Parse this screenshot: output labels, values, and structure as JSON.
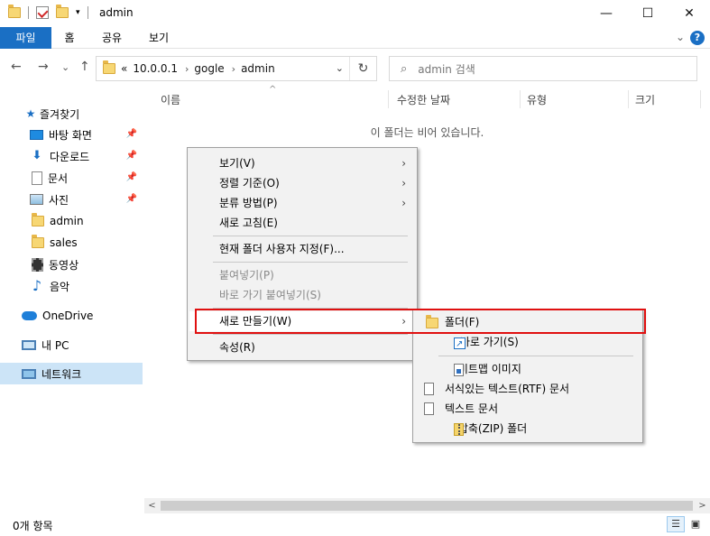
{
  "title_bar": {
    "title": "admin",
    "minimize": "—",
    "maximize": "☐",
    "close": "✕",
    "qa_dropdown": "▾"
  },
  "ribbon": {
    "tabs": [
      "파일",
      "홈",
      "공유",
      "보기"
    ],
    "expand": "⌄",
    "help": "?"
  },
  "nav": {
    "back": "←",
    "forward": "→",
    "recent": "⌄",
    "up": "↑",
    "overflow": "«",
    "breadcrumbs": [
      "10.0.0.1",
      "gogle",
      "admin"
    ],
    "chevron": "›",
    "dropdown": "⌄",
    "refresh": "↻",
    "search_placeholder": "admin 검색"
  },
  "sidebar": {
    "quick_access": "즐겨찾기",
    "items": [
      {
        "label": "바탕 화면",
        "icon": "desktop-icon",
        "pinned": true
      },
      {
        "label": "다운로드",
        "icon": "download-icon",
        "pinned": true
      },
      {
        "label": "문서",
        "icon": "document-icon",
        "pinned": true
      },
      {
        "label": "사진",
        "icon": "pictures-icon",
        "pinned": true
      },
      {
        "label": "admin",
        "icon": "folder-icon",
        "pinned": false
      },
      {
        "label": "sales",
        "icon": "folder-icon",
        "pinned": false
      },
      {
        "label": "동영상",
        "icon": "video-icon",
        "pinned": false
      },
      {
        "label": "음악",
        "icon": "music-icon",
        "pinned": false
      }
    ],
    "onedrive": "OneDrive",
    "this_pc": "내 PC",
    "network": "네트워크",
    "pin_glyph": "📌"
  },
  "columns": {
    "name": "이름",
    "modified": "수정한 날짜",
    "type": "유형",
    "size": "크기",
    "sort_indicator": "^"
  },
  "empty_message": "이 폴더는 비어 있습니다.",
  "status": {
    "item_count": "0개 항목"
  },
  "scrollbar": {
    "left": "<",
    "right": ">"
  },
  "context_menu": {
    "items": {
      "view": "보기(V)",
      "sort_by": "정렬 기준(O)",
      "group_by": "분류 방법(P)",
      "refresh": "새로 고침(E)",
      "customize": "현재 폴더 사용자 지정(F)...",
      "paste": "붙여넣기(P)",
      "paste_shortcut": "바로 가기 붙여넣기(S)",
      "new": "새로 만들기(W)",
      "properties": "속성(R)"
    },
    "submenu_arrow": "›"
  },
  "submenu": {
    "folder": "폴더(F)",
    "shortcut": "바로 가기(S)",
    "bitmap": "비트맵 이미지",
    "rtf": "서식있는 텍스트(RTF) 문서",
    "text": "텍스트 문서",
    "zip": "압축(ZIP) 폴더"
  },
  "colors": {
    "accent": "#1a6fc4",
    "highlight_box": "#e01010",
    "selected_nav": "#cce4f7"
  }
}
